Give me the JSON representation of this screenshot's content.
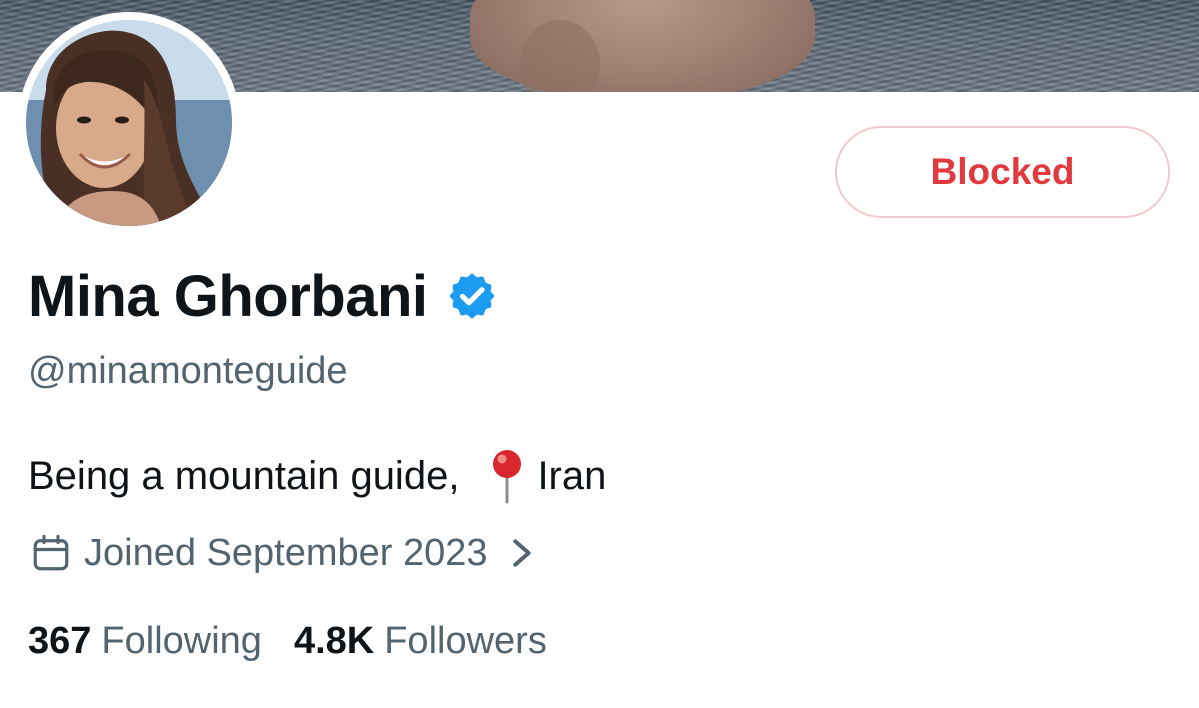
{
  "profile": {
    "display_name": "Mina Ghorbani",
    "handle": "@minamonteguide",
    "verified": true,
    "bio_text": "Being a mountain guide,",
    "location": "Iran",
    "joined": "Joined September 2023"
  },
  "actions": {
    "blocked_label": "Blocked"
  },
  "stats": {
    "following_count": "367",
    "following_label": "Following",
    "followers_count": "4.8K",
    "followers_label": "Followers"
  },
  "colors": {
    "blocked_text": "#e0393e",
    "blocked_border": "#f3c9cd",
    "verified_badge": "#1d9bf0",
    "secondary_text": "#536471",
    "primary_text": "#0f1419"
  },
  "icons": {
    "verified": "verified-badge-icon",
    "location": "round-pushpin-icon",
    "joined": "calendar-icon",
    "expand": "chevron-right-icon"
  }
}
